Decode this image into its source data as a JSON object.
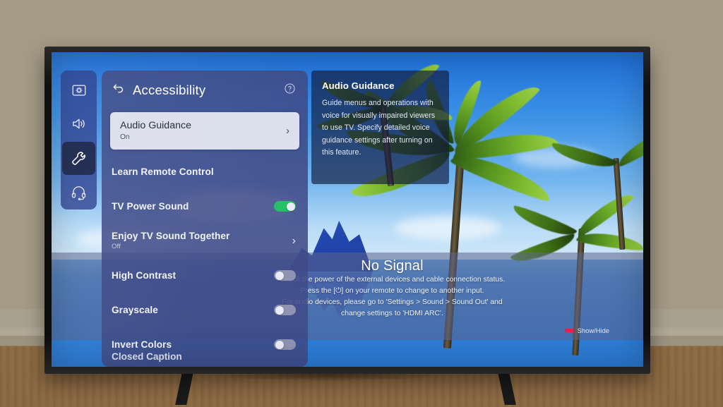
{
  "tv": {
    "screen_label": "tv-screen"
  },
  "icon_rail": {
    "items": [
      {
        "name": "picture-settings-icon",
        "icon": "display-gear-icon",
        "active": false
      },
      {
        "name": "sound-settings-icon",
        "icon": "speaker-icon",
        "active": false
      },
      {
        "name": "general-settings-icon",
        "icon": "wrench-icon",
        "active": true
      },
      {
        "name": "support-settings-icon",
        "icon": "headset-icon",
        "active": false
      }
    ]
  },
  "settings_panel": {
    "back_icon": "back-arrow-icon",
    "title": "Accessibility",
    "help_icon": "help-circle-icon",
    "selected": {
      "label": "Audio Guidance",
      "value": "On",
      "chevron": "›"
    },
    "items": [
      {
        "label": "Learn Remote Control",
        "sub": "",
        "control": "none"
      },
      {
        "label": "TV Power Sound",
        "sub": "",
        "control": "toggle",
        "state": "on"
      },
      {
        "label": "Enjoy TV Sound Together",
        "sub": "Off",
        "control": "chevron",
        "chevron": "›"
      },
      {
        "label": "High Contrast",
        "sub": "",
        "control": "toggle",
        "state": "off"
      },
      {
        "label": "Grayscale",
        "sub": "",
        "control": "toggle",
        "state": "off"
      },
      {
        "label": "Invert Colors",
        "sub": "",
        "control": "toggle",
        "state": "off"
      }
    ],
    "cut_off_item": "Closed Caption"
  },
  "description_panel": {
    "title": "Audio Guidance",
    "body": "Guide menus and operations with voice for visually impaired viewers to use TV. Specify detailed voice guidance settings after turning on this feature."
  },
  "no_signal": {
    "title": "No Signal",
    "lines": [
      "Check the power of the external devices and cable connection status.",
      "Press the [⏻] on your remote to change to another input.",
      "For audio devices, please go to 'Settings > Sound > Sound Out' and",
      "change settings to 'HDMI ARC'."
    ],
    "showhide_label": "Show/Hide",
    "showhide_key_color": "#d9294a"
  },
  "colors": {
    "panel_bg": "#404b88",
    "rail_bg": "#2c3c8c",
    "selected_row_bg": "#dcdfec",
    "toggle_on": "#25c067",
    "toggle_off": "#8d93b1",
    "wall": "#a49a85",
    "floor": "#8c6a42",
    "bezel": "#101010"
  }
}
